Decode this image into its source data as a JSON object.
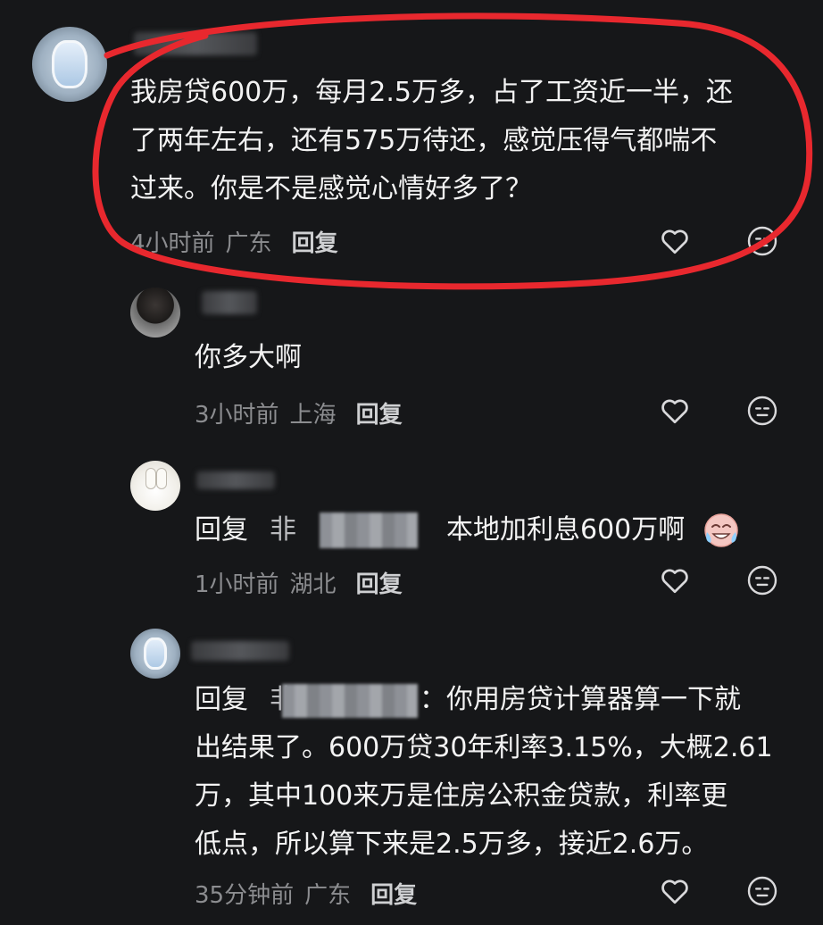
{
  "comments": [
    {
      "text_lines": [
        "我房贷600万，每月2.5万多，占了工资近一半，还",
        "了两年左右，还有575万待还，感觉压得气都喘不",
        "过来。你是不是感觉心情好多了？"
      ],
      "time": "4小时前",
      "location": "广东",
      "reply_label": "回复",
      "avatar": "airplane-window-avatar"
    },
    {
      "text_lines": [
        "你多大啊"
      ],
      "time": "3小时前",
      "location": "上海",
      "reply_label": "回复",
      "avatar": "photo-avatar"
    },
    {
      "reply_prefix": "回复",
      "reply_to_partial": "非",
      "text_lines": [
        "本地加利息600万啊"
      ],
      "emoji": "crying-laughing-emoji",
      "time": "1小时前",
      "location": "湖北",
      "reply_label": "回复",
      "avatar": "bunny-avatar"
    },
    {
      "reply_prefix": "回复",
      "reply_to_partial": "非",
      "text_lines": [
        "：你用房贷计算器算一下就",
        "出结果了。600万贷30年利率3.15%，大概2.61",
        "万，其中100来万是住房公积金贷款，利率更",
        "低点，所以算下来是2.5万多，接近2.6万。"
      ],
      "time": "35分钟前",
      "location": "广东",
      "reply_label": "回复",
      "avatar": "airplane-window-avatar"
    }
  ],
  "icons": {
    "like": "heart-icon",
    "dislike": "neutral-face-icon"
  },
  "colors": {
    "background": "#161719",
    "annotation": "#e8282e",
    "meta_text": "#8c8d90"
  }
}
